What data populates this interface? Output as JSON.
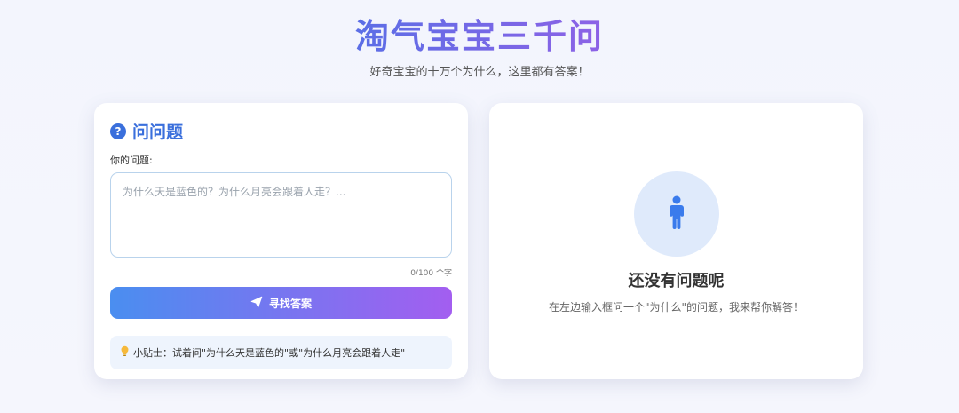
{
  "header": {
    "title": "淘气宝宝三千问",
    "subtitle": "好奇宝宝的十万个为什么，这里都有答案！"
  },
  "ask_panel": {
    "heading_icon": "question-circle-icon",
    "heading": "问问题",
    "field_label": "你的问题:",
    "input_value": "",
    "input_placeholder": "为什么天是蓝色的？为什么月亮会跟着人走？...",
    "char_counter": "0/100 个字",
    "submit_icon": "paper-plane-icon",
    "submit_label": "寻找答案",
    "tip_icon": "lightbulb-icon",
    "tip_text": "小贴士：试着问\"为什么天是蓝色的\"或\"为什么月亮会跟着人走\""
  },
  "answer_panel": {
    "empty_icon": "child-icon",
    "empty_title": "还没有问题呢",
    "empty_description": "在左边输入框问一个\"为什么\"的问题，我来帮你解答！"
  },
  "colors": {
    "accent_blue": "#3a6fdc",
    "button_gradient_start": "#4a8ef0",
    "button_gradient_end": "#a35ef0",
    "title_gradient_start": "#5b6ee6",
    "title_gradient_end": "#8d62e6"
  }
}
